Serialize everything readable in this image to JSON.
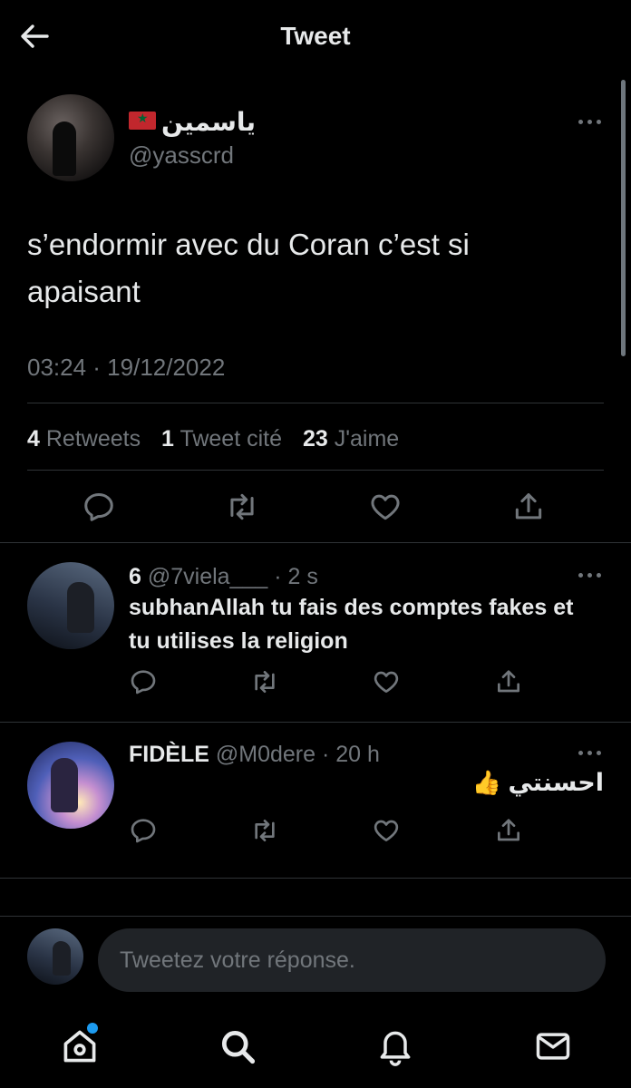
{
  "header": {
    "title": "Tweet"
  },
  "main_tweet": {
    "display_name": "ياسمين",
    "handle": "@yasscrd",
    "text": "s’endormir avec du Coran c’est si apaisant",
    "timestamp": "03:24 · 19/12/2022",
    "stats": {
      "retweets_count": "4",
      "retweets_label": "Retweets",
      "quotes_count": "1",
      "quotes_label": "Tweet cité",
      "likes_count": "23",
      "likes_label": "J'aime"
    }
  },
  "replies": [
    {
      "name": "6",
      "handle": "@7viela___",
      "time": "· 2 s",
      "text": "subhanAllah tu fais des comptes fakes et tu utilises la religion"
    },
    {
      "name": "FIDÈLE",
      "handle": "@M0dere",
      "time": "· 20 h",
      "text": "احسنتي",
      "emoji": "👍"
    }
  ],
  "compose": {
    "placeholder": "Tweetez votre réponse."
  },
  "icons": {
    "back": "arrow-left-icon",
    "more": "more-icon",
    "reply": "reply-icon",
    "retweet": "retweet-icon",
    "like": "heart-icon",
    "share": "share-icon",
    "home": "home-icon",
    "search": "search-icon",
    "notifications": "bell-icon",
    "messages": "mail-icon"
  },
  "colors": {
    "background": "#000000",
    "text": "#e7e9ea",
    "muted": "#71767b",
    "accent": "#1d9bf0",
    "divider": "#2f3336"
  }
}
